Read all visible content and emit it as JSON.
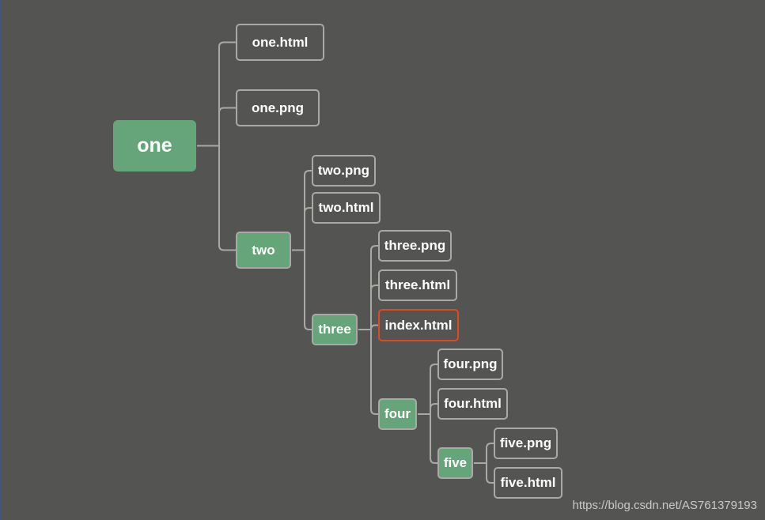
{
  "diagram": {
    "type": "mind-map",
    "colors": {
      "background": "#545552",
      "branch_fill": "#66a47a",
      "leaf_border": "#a9a9a6",
      "highlight_border": "#e04a1c",
      "connector": "#a9a9a6"
    },
    "nodes": {
      "one": "one",
      "one_html": "one.html",
      "one_png": "one.png",
      "two": "two",
      "two_png": "two.png",
      "two_html": "two.html",
      "three": "three",
      "three_png": "three.png",
      "three_html": "three.html",
      "index_html": "index.html",
      "four": "four",
      "four_png": "four.png",
      "four_html": "four.html",
      "five": "five",
      "five_png": "five.png",
      "five_html": "five.html"
    },
    "tree": {
      "id": "one",
      "children": [
        {
          "id": "one_html"
        },
        {
          "id": "one_png"
        },
        {
          "id": "two",
          "children": [
            {
              "id": "two_png"
            },
            {
              "id": "two_html"
            },
            {
              "id": "three",
              "children": [
                {
                  "id": "three_png"
                },
                {
                  "id": "three_html"
                },
                {
                  "id": "index_html",
                  "highlighted": true
                },
                {
                  "id": "four",
                  "children": [
                    {
                      "id": "four_png"
                    },
                    {
                      "id": "four_html"
                    },
                    {
                      "id": "five",
                      "children": [
                        {
                          "id": "five_png"
                        },
                        {
                          "id": "five_html"
                        }
                      ]
                    }
                  ]
                }
              ]
            }
          ]
        }
      ]
    }
  },
  "watermark": "https://blog.csdn.net/AS761379193"
}
